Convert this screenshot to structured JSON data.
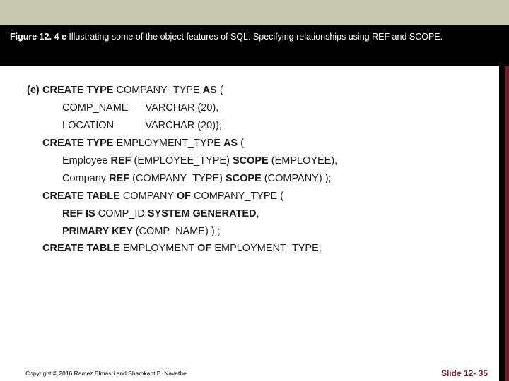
{
  "caption": {
    "fig_label": "Figure 12. 4 e",
    "text_rest": "   Illustrating some of the object features of SQL. Specifying relationships using REF and SCOPE."
  },
  "code": {
    "marker": "(e)",
    "l1": {
      "a": "CREATE TYPE ",
      "b": "COMPANY_TYPE ",
      "c": "AS ",
      "d": "("
    },
    "l2": "COMP_NAME      VARCHAR (20),",
    "l3": "LOCATION           VARCHAR (20));",
    "l4": {
      "a": "CREATE TYPE ",
      "b": "EMPLOYMENT_TYPE ",
      "c": "AS ",
      "d": "("
    },
    "l5": {
      "a": "Employee ",
      "b": "REF ",
      "c": "(EMPLOYEE_TYPE) ",
      "d": "SCOPE ",
      "e": "(EMPLOYEE),"
    },
    "l6": {
      "a": "Company ",
      "b": "REF ",
      "c": "(COMPANY_TYPE) ",
      "d": "SCOPE ",
      "e": "(COMPANY) );"
    },
    "l7": {
      "a": "CREATE TABLE ",
      "b": "COMPANY ",
      "c": "OF ",
      "d": "COMPANY_TYPE ("
    },
    "l8": {
      "a": "REF IS ",
      "b": "COMP_ID ",
      "c": "SYSTEM GENERATED",
      "d": ","
    },
    "l9": {
      "a": "PRIMARY KEY ",
      "b": "(COMP_NAME) ) ;"
    },
    "l10": {
      "a": "CREATE TABLE ",
      "b": "EMPLOYMENT ",
      "c": "OF ",
      "d": "EMPLOYMENT_TYPE;"
    }
  },
  "footer": {
    "copyright": "Copyright © 2016 Ramez Elmasri and Shamkant B. Navathe",
    "slide": "Slide 12- 35"
  }
}
